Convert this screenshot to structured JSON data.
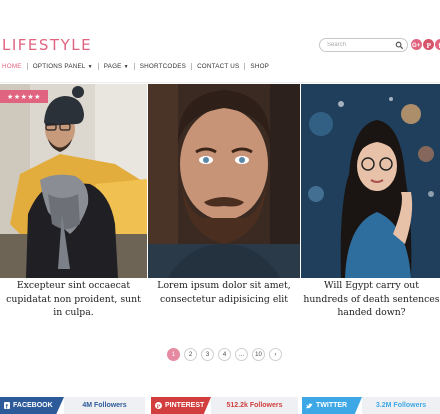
{
  "header": {
    "logo": "LIFESTYLE",
    "search": {
      "placeholder": "Search"
    },
    "social_icons": [
      "google-plus-icon",
      "pinterest-icon",
      "facebook-icon"
    ]
  },
  "nav": {
    "items": [
      {
        "label": "HOME",
        "active": true
      },
      {
        "label": "OPTIONS PANEL",
        "dropdown": true
      },
      {
        "label": "PAGE",
        "dropdown": true
      },
      {
        "label": "SHORTCODES"
      },
      {
        "label": "CONTACT US"
      },
      {
        "label": "SHOP"
      }
    ]
  },
  "posts": [
    {
      "title": "Excepteur sint occaecat cupidatat non proident, sunt in culpa.",
      "rating": "★★★★★"
    },
    {
      "title": "Lorem ipsum dolor sit amet, consectetur adipisicing elit"
    },
    {
      "title": "Will Egypt carry out hundreds of death sentences handed down?"
    }
  ],
  "pagination": {
    "pages": [
      "1",
      "2",
      "3",
      "4",
      "...",
      "10",
      "›"
    ],
    "current": "1"
  },
  "social_follow": [
    {
      "network": "FACEBOOK",
      "count": "4M Followers",
      "color": "#2d5b9a"
    },
    {
      "network": "PINTEREST",
      "count": "512.2k Followers",
      "color": "#d23e3e"
    },
    {
      "network": "TWITTER",
      "count": "3.2M Followers",
      "color": "#3ea8e6"
    }
  ],
  "colors": {
    "accent": "#e0647f"
  }
}
